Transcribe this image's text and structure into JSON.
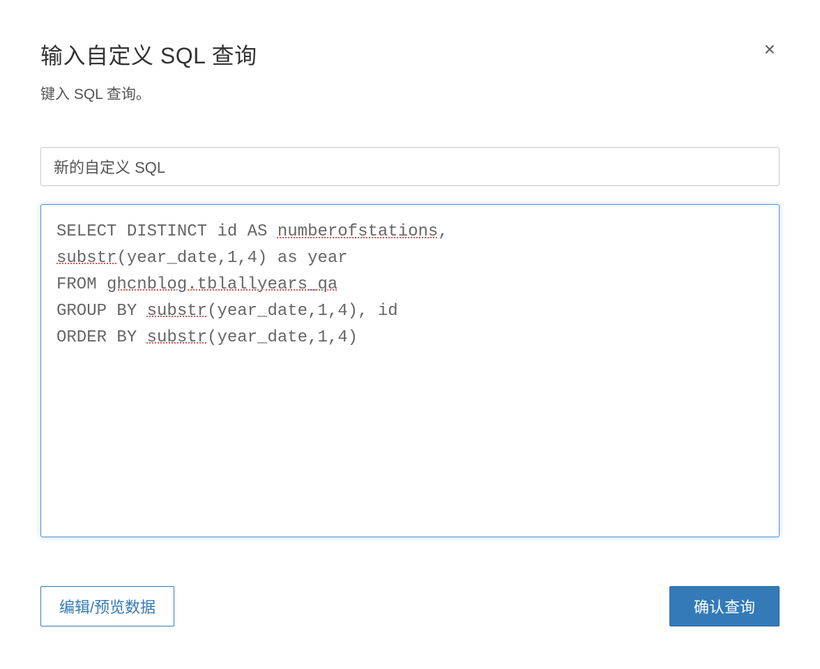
{
  "dialog": {
    "title": "输入自定义 SQL 查询",
    "subtitle": "键入 SQL 查询。",
    "close_icon": "×"
  },
  "name_input": {
    "value": "新的自定义 SQL"
  },
  "sql": {
    "line1_a": "SELECT DISTINCT id AS ",
    "line1_spell": "numberofstations",
    "line1_b": ",",
    "line2_a": "substr",
    "line2_b": "(year_date,1,4) as year",
    "line3_a": "FROM ",
    "line3_spell": "ghcnblog.tblallyears_qa",
    "line4_a": "GROUP BY ",
    "line4_spell": "substr",
    "line4_b": "(year_date,1,4), id",
    "line5_a": "ORDER BY ",
    "line5_spell": "substr",
    "line5_b": "(year_date,1,4)"
  },
  "buttons": {
    "edit_preview": "编辑/预览数据",
    "confirm": "确认查询"
  }
}
